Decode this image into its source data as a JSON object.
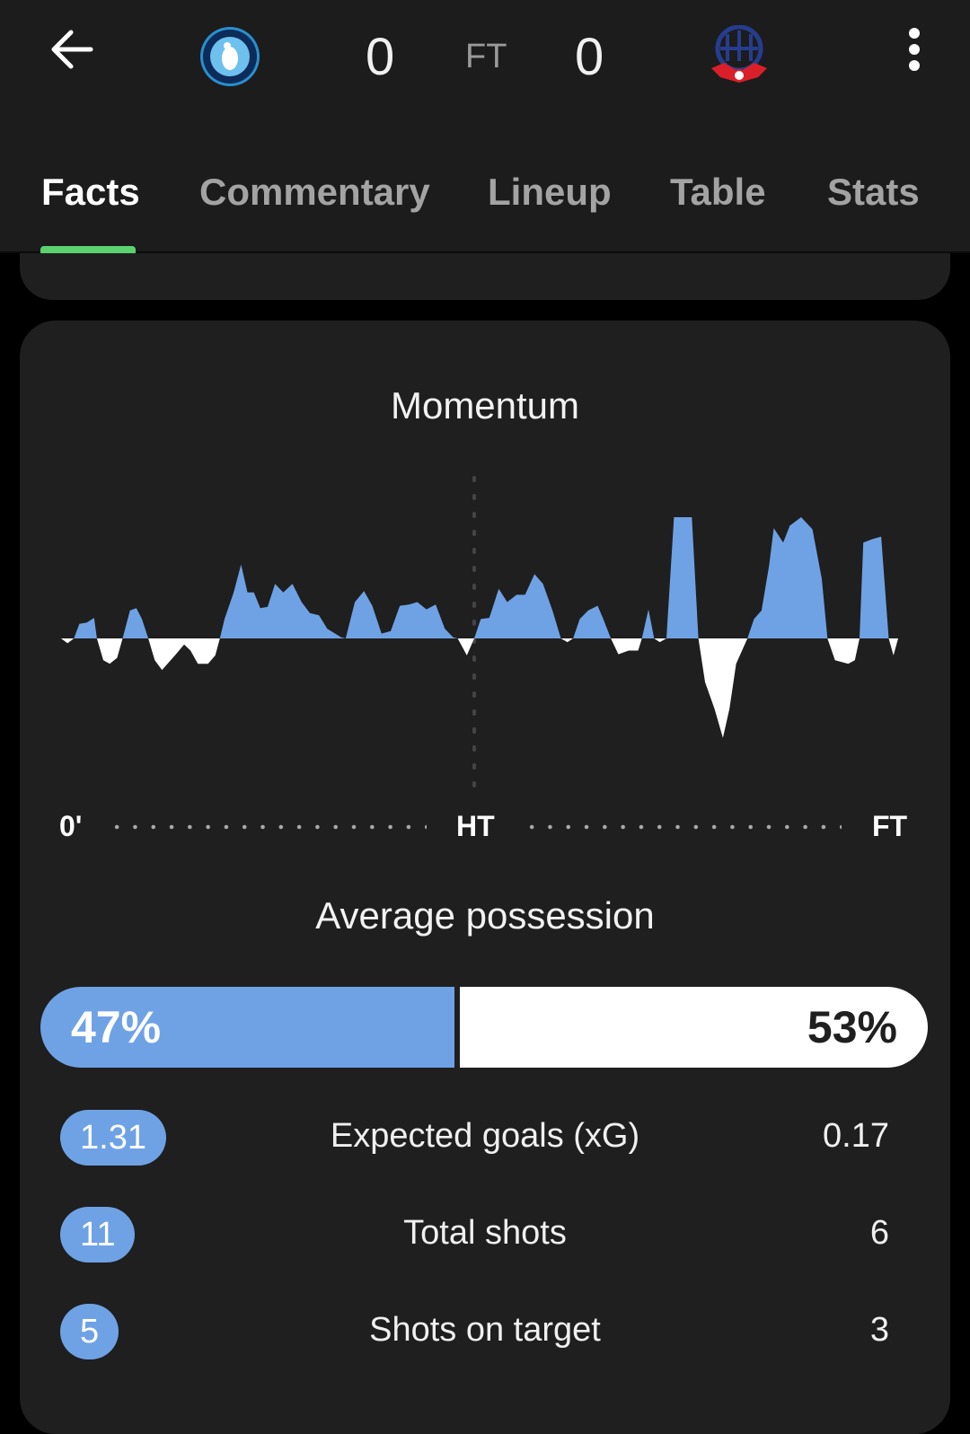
{
  "header": {
    "home_team_logo": "Wycombe Wanderers crest",
    "away_team_logo": "Bolton Wanderers crest",
    "home_score": "0",
    "away_score": "0",
    "status": "FT",
    "back_icon": "arrow-left-icon",
    "menu_icon": "more-vertical-icon"
  },
  "tabs": [
    {
      "label": "Facts",
      "active": true
    },
    {
      "label": "Commentary",
      "active": false
    },
    {
      "label": "Lineup",
      "active": false
    },
    {
      "label": "Table",
      "active": false
    },
    {
      "label": "Stats",
      "active": false
    }
  ],
  "momentum": {
    "title": "Momentum",
    "axis_labels": {
      "start": "0'",
      "half": "HT",
      "end": "FT"
    }
  },
  "chart_data": {
    "type": "area",
    "title": "Momentum",
    "x_tick_labels": [
      "0'",
      "HT",
      "FT"
    ],
    "xlim": [
      0,
      90
    ],
    "ylim": [
      -100,
      100
    ],
    "home_color": "#6fa2e5",
    "away_color": "#ffffff",
    "x": [
      0,
      0.7,
      1.4,
      2.0,
      2.8,
      3.6,
      3.9,
      4.6,
      5.3,
      6.1,
      6.7,
      7.5,
      8.2,
      8.8,
      9.5,
      10.2,
      11.0,
      11.7,
      12.4,
      13.4,
      14.1,
      14.9,
      16.0,
      16.8,
      17.3,
      17.8,
      18.8,
      19.6,
      20.3,
      21.0,
      21.7,
      22.5,
      23.3,
      24.2,
      25.2,
      26.2,
      27.1,
      28.1,
      29.0,
      30.5,
      31.0,
      32.0,
      33.0,
      33.9,
      34.9,
      35.9,
      36.9,
      37.9,
      38.8,
      39.8,
      40.8,
      41.8,
      42.7,
      43.2,
      44.2,
      45,
      45.7,
      46.6,
      47.6,
      48.5,
      49.5,
      50.4,
      51.4,
      52.3,
      53.3,
      54.2,
      54.9,
      55.5,
      56.2,
      57.1,
      58.1,
      58.7,
      59.5,
      60.3,
      61.4,
      62.4,
      62.8,
      63.5,
      64.1,
      64.7,
      65.4,
      66.2,
      68.1,
      68.8,
      69.5,
      70.5,
      71.4,
      72.1,
      72.8,
      74.0,
      74.7,
      75.5,
      76.3,
      76.8,
      77.8,
      78.5,
      79.7,
      80.9,
      81.9,
      82.5,
      83.3,
      84.7,
      85.4,
      85.9,
      86.3,
      87.3,
      88.2,
      89.0,
      89.5,
      90
    ],
    "y": [
      0,
      -4,
      0,
      12,
      13,
      17,
      0,
      -18,
      -21,
      -16,
      0,
      23,
      25,
      16,
      0,
      -18,
      -26,
      -20,
      -14,
      -5,
      -10,
      -21,
      -21,
      -14,
      0,
      16,
      38,
      61,
      38,
      38,
      25,
      26,
      45,
      38,
      45,
      30,
      21,
      19,
      8,
      1,
      0,
      30,
      39,
      27,
      4,
      6,
      27,
      28,
      30,
      24,
      28,
      8,
      1,
      0,
      -14,
      0,
      16,
      17,
      41,
      30,
      36,
      36,
      53,
      45,
      23,
      0,
      -3,
      0,
      16,
      23,
      27,
      16,
      0,
      -13,
      -10,
      -10,
      0,
      24,
      0,
      -3,
      0,
      100,
      100,
      0,
      -36,
      -58,
      -82,
      -58,
      -21,
      0,
      16,
      23,
      60,
      91,
      79,
      93,
      100,
      90,
      49,
      0,
      -18,
      -21,
      -18,
      0,
      79,
      82,
      84,
      0,
      -14,
      0
    ]
  },
  "possession": {
    "title": "Average possession",
    "home": 47,
    "away": 53,
    "home_label": "47%",
    "away_label": "53%"
  },
  "stats": [
    {
      "label": "Expected goals (xG)",
      "home": "1.31",
      "away": "0.17"
    },
    {
      "label": "Total shots",
      "home": "11",
      "away": "6"
    },
    {
      "label": "Shots on target",
      "home": "5",
      "away": "3"
    }
  ]
}
